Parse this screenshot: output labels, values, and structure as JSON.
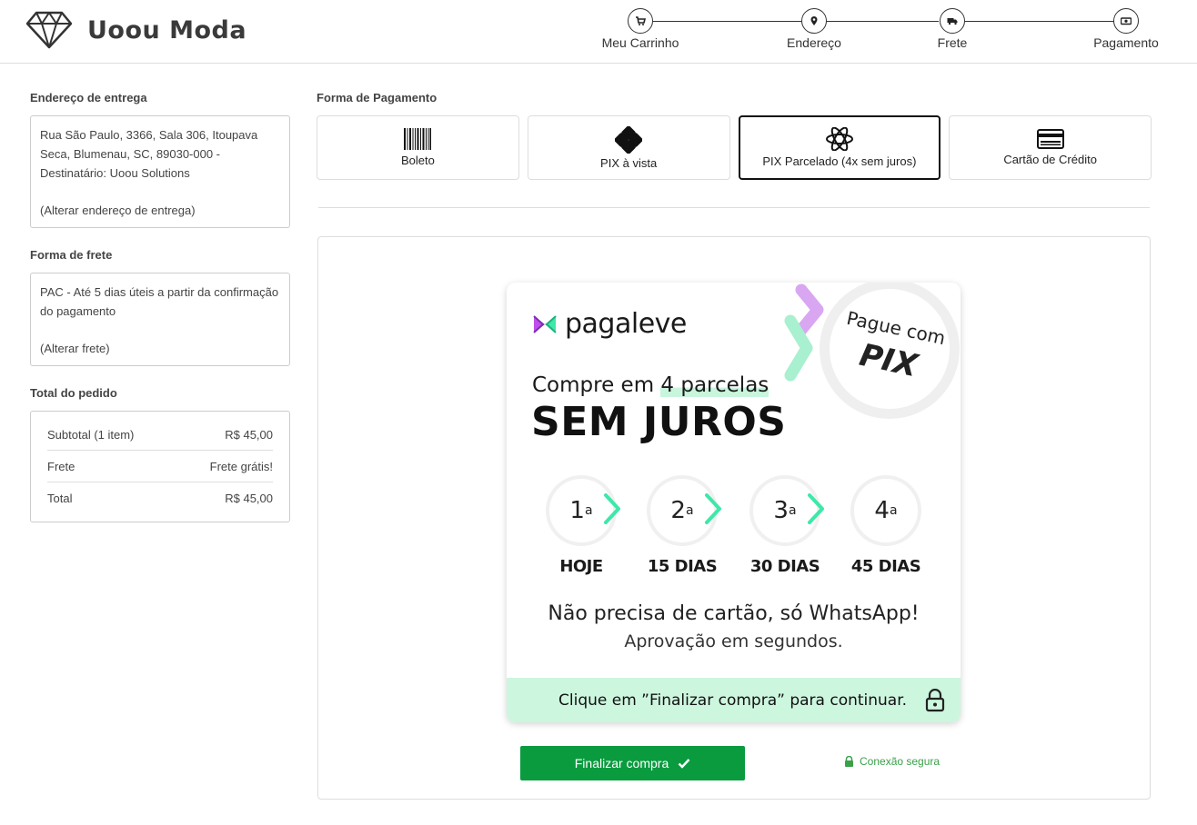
{
  "header": {
    "brand": "Uoou Moda",
    "steps": [
      {
        "label": "Meu Carrinho",
        "icon": "cart-icon"
      },
      {
        "label": "Endereço",
        "icon": "map-pin-icon"
      },
      {
        "label": "Frete",
        "icon": "truck-icon"
      },
      {
        "label": "Pagamento",
        "icon": "money-icon"
      }
    ]
  },
  "left": {
    "address_title": "Endereço de entrega",
    "address_text": "Rua São Paulo, 3366, Sala 306, Itoupava Seca, Blumenau, SC, 89030-000 - Destinatário: Uoou Solutions",
    "address_change": "(Alterar endereço de entrega)",
    "shipping_title": "Forma de frete",
    "shipping_text": "PAC - Até 5 dias úteis a partir da confirmação do pagamento",
    "shipping_change": "(Alterar frete)",
    "total_title": "Total do pedido",
    "totals": [
      {
        "label": "Subtotal (1 item)",
        "value": "R$ 45,00"
      },
      {
        "label": "Frete",
        "value": "Frete grátis!"
      },
      {
        "label": "Total",
        "value": "R$ 45,00"
      }
    ]
  },
  "payment": {
    "title": "Forma de Pagamento",
    "options": [
      {
        "label": "Boleto",
        "icon": "barcode-icon",
        "selected": false
      },
      {
        "label": "PIX à vista",
        "icon": "pix-icon",
        "selected": false
      },
      {
        "label": "PIX Parcelado (4x sem juros)",
        "icon": "pagaleve-icon",
        "selected": true
      },
      {
        "label": "Cartão de Crédito",
        "icon": "credit-card-icon",
        "selected": false
      }
    ]
  },
  "card": {
    "logo_text": "pagaleve",
    "pix_line1": "Pague com",
    "pix_line2": "PIX",
    "compre_prefix": "Compre em",
    "compre_highlight": "4 parcelas",
    "sem_juros": "SEM JUROS",
    "installments": [
      {
        "num": "1",
        "sup": "a",
        "label": "HOJE"
      },
      {
        "num": "2",
        "sup": "a",
        "label": "15 DIAS"
      },
      {
        "num": "3",
        "sup": "a",
        "label": "30 DIAS"
      },
      {
        "num": "4",
        "sup": "a",
        "label": "45 DIAS"
      }
    ],
    "nao_precisa": "Não precisa de cartão, só WhatsApp!",
    "aprovacao": "Aprovação em segundos.",
    "footer_text": "Clique em ”Finalizar compra” para continuar."
  },
  "actions": {
    "finalizar": "Finalizar compra",
    "secure": "Conexão segura"
  },
  "colors": {
    "accent_green": "#0a9b3f",
    "mint": "#cdf6df",
    "chevron_green": "#3ee8a8",
    "pagaleve_purple": "#c04ee8"
  }
}
